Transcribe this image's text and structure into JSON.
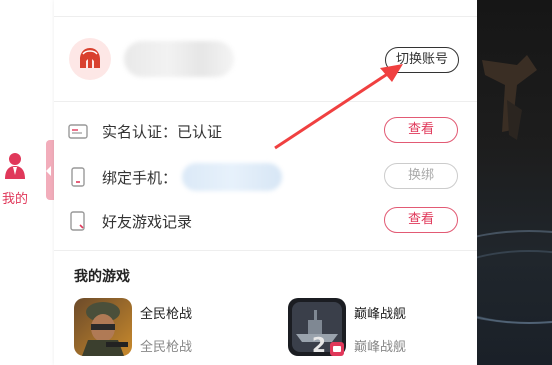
{
  "left_nav": {
    "me_label": "我的"
  },
  "account": {
    "switch_label": "切换账号"
  },
  "rows": [
    {
      "label": "实名认证：已认证",
      "button": "查看",
      "icon": "id-card-icon"
    },
    {
      "label": "绑定手机：",
      "button": "换绑",
      "icon": "phone-icon"
    },
    {
      "label": "好友游戏记录",
      "button": "查看",
      "icon": "document-icon"
    }
  ],
  "games": {
    "title": "我的游戏",
    "items": [
      {
        "name": "全民枪战",
        "sub": "全民枪战"
      },
      {
        "name": "巅峰战舰",
        "sub": "巅峰战舰"
      }
    ]
  },
  "colors": {
    "accent": "#e0385a",
    "annotation_arrow": "#f04040"
  }
}
